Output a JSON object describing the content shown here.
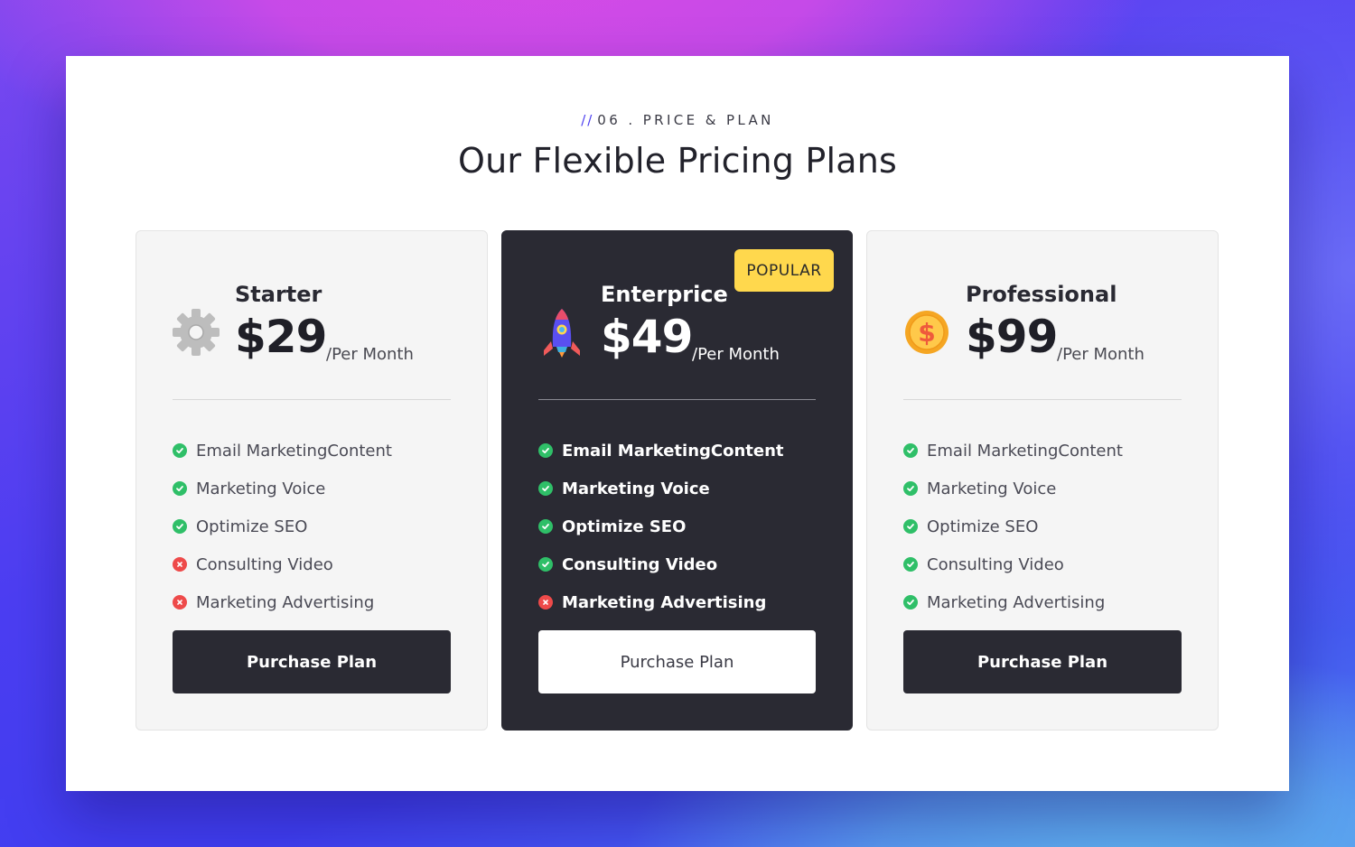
{
  "header": {
    "eyebrow_marker": "//",
    "eyebrow": "06 . PRICE & PLAN",
    "title": "Our Flexible Pricing Plans"
  },
  "colors": {
    "accent": "#4b3ef0",
    "dark_card": "#2a2a33",
    "badge": "#ffd84d",
    "check": "#2fbf68",
    "cross": "#ee4a4a"
  },
  "plans": [
    {
      "icon": "gear-icon",
      "name": "Starter",
      "price": "$29",
      "period": "/Per Month",
      "features": [
        {
          "label": "Email MarketingContent",
          "included": true
        },
        {
          "label": "Marketing Voice",
          "included": true
        },
        {
          "label": "Optimize SEO",
          "included": true
        },
        {
          "label": "Consulting Video",
          "included": false
        },
        {
          "label": "Marketing Advertising",
          "included": false
        }
      ],
      "button": "Purchase Plan"
    },
    {
      "icon": "rocket-icon",
      "badge": "POPULAR",
      "name": "Enterprice",
      "price": "$49",
      "period": "/Per Month",
      "features": [
        {
          "label": "Email MarketingContent",
          "included": true
        },
        {
          "label": "Marketing Voice",
          "included": true
        },
        {
          "label": "Optimize SEO",
          "included": true
        },
        {
          "label": "Consulting Video",
          "included": true
        },
        {
          "label": "Marketing Advertising",
          "included": false
        }
      ],
      "button": "Purchase Plan"
    },
    {
      "icon": "dollar-coin-icon",
      "name": "Professional",
      "price": "$99",
      "period": "/Per Month",
      "features": [
        {
          "label": "Email MarketingContent",
          "included": true
        },
        {
          "label": "Marketing Voice",
          "included": true
        },
        {
          "label": "Optimize SEO",
          "included": true
        },
        {
          "label": "Consulting Video",
          "included": true
        },
        {
          "label": "Marketing Advertising",
          "included": true
        }
      ],
      "button": "Purchase Plan"
    }
  ]
}
